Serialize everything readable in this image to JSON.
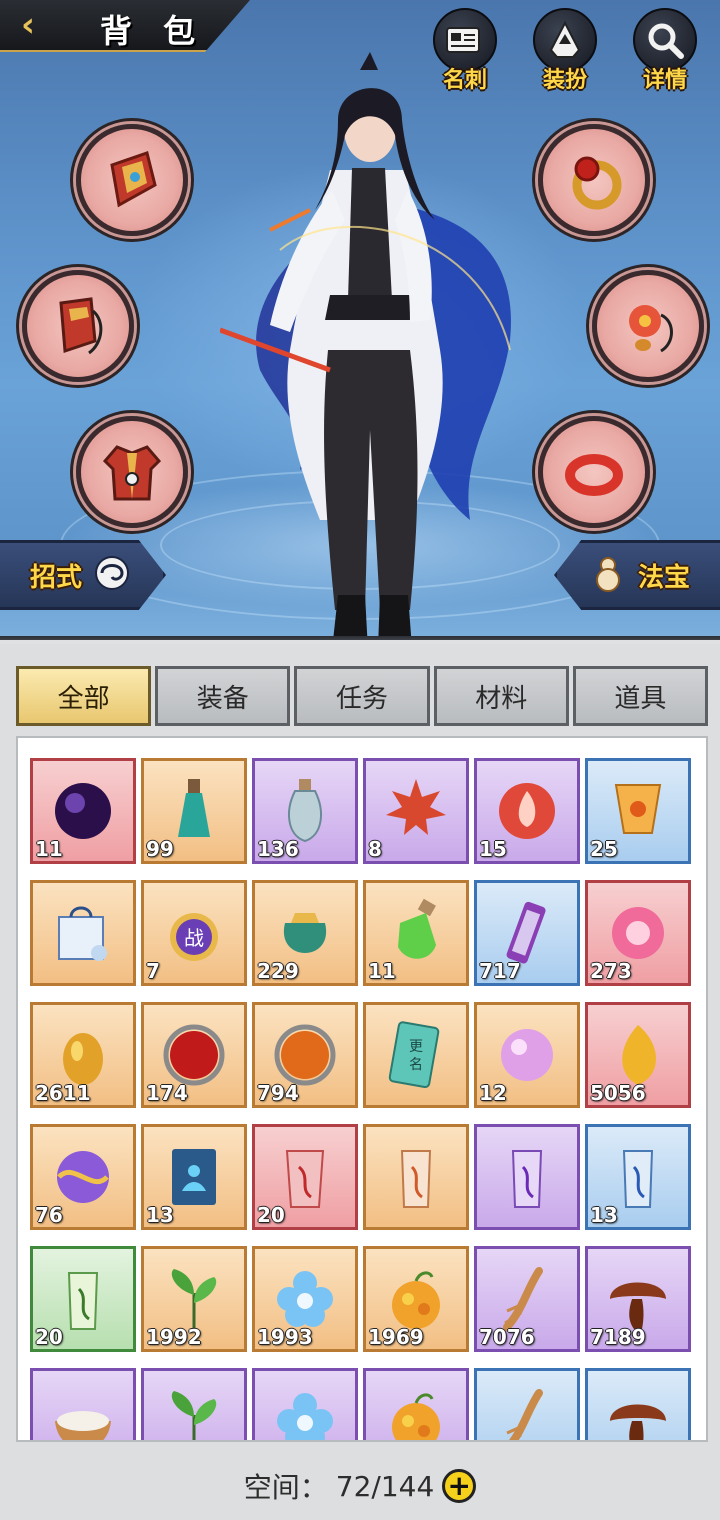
{
  "header": {
    "back_icon": "chevron-left-icon",
    "title": "背 包",
    "buttons": [
      {
        "key": "card",
        "label": "名刺",
        "icon": "name-card-icon"
      },
      {
        "key": "outfit",
        "label": "装扮",
        "icon": "hooded-figure-icon"
      },
      {
        "key": "details",
        "label": "详情",
        "icon": "magnifier-icon"
      }
    ]
  },
  "equipment_slots": {
    "left": [
      {
        "key": "weapon",
        "icon": "bracer-armor-icon"
      },
      {
        "key": "helmet",
        "icon": "hood-icon"
      },
      {
        "key": "armor",
        "icon": "robe-icon"
      }
    ],
    "right": [
      {
        "key": "ring",
        "icon": "gem-ring-icon"
      },
      {
        "key": "amulet",
        "icon": "flower-pendant-icon"
      },
      {
        "key": "bracelet",
        "icon": "red-bangle-icon"
      }
    ]
  },
  "side_tabs": {
    "skills": {
      "label": "招式",
      "icon": "swirl-icon"
    },
    "treasure": {
      "label": "法宝",
      "icon": "gourd-icon"
    }
  },
  "colors": {
    "accent_gold": "#ffd84a",
    "slot_fill": "#e9a9a4",
    "tab_active": "#e8c76f",
    "rarity_red": "#ef9fa3",
    "rarity_orange": "#f2bf84",
    "rarity_purple": "#c9a9ea",
    "rarity_blue": "#a9cdef",
    "rarity_green": "#b7dfaf"
  },
  "tabs": [
    {
      "label": "全部",
      "active": true
    },
    {
      "label": "装备",
      "active": false
    },
    {
      "label": "任务",
      "active": false
    },
    {
      "label": "材料",
      "active": false
    },
    {
      "label": "道具",
      "active": false
    }
  ],
  "items": [
    {
      "icon": "dark-orb-icon",
      "count": "11",
      "rarity": "red"
    },
    {
      "icon": "teal-potion-icon",
      "count": "99",
      "rarity": "orange"
    },
    {
      "icon": "porcelain-vase-icon",
      "count": "136",
      "rarity": "purple"
    },
    {
      "icon": "maple-leaf-icon",
      "count": "8",
      "rarity": "purple"
    },
    {
      "icon": "fire-token-icon",
      "count": "15",
      "rarity": "purple"
    },
    {
      "icon": "sky-lantern-icon",
      "count": "25",
      "rarity": "blue"
    },
    {
      "icon": "gift-bag-icon",
      "count": "",
      "rarity": "orange"
    },
    {
      "icon": "battle-medal-icon",
      "count": "7",
      "rarity": "orange"
    },
    {
      "icon": "green-pouch-icon",
      "count": "229",
      "rarity": "orange"
    },
    {
      "icon": "green-potion-icon",
      "count": "11",
      "rarity": "orange"
    },
    {
      "icon": "purple-scroll-icon",
      "count": "717",
      "rarity": "blue"
    },
    {
      "icon": "lotus-orb-icon",
      "count": "273",
      "rarity": "red"
    },
    {
      "icon": "gold-nugget-icon",
      "count": "2611",
      "rarity": "orange"
    },
    {
      "icon": "red-orb-icon",
      "count": "174",
      "rarity": "orange"
    },
    {
      "icon": "orange-orb-icon",
      "count": "794",
      "rarity": "orange"
    },
    {
      "icon": "rename-card-icon",
      "count": "",
      "rarity": "orange"
    },
    {
      "icon": "pink-pearl-icon",
      "count": "12",
      "rarity": "orange"
    },
    {
      "icon": "gold-leaf-icon",
      "count": "5056",
      "rarity": "red"
    },
    {
      "icon": "galaxy-orb-icon",
      "count": "76",
      "rarity": "orange"
    },
    {
      "icon": "meditation-book-icon",
      "count": "13",
      "rarity": "orange"
    },
    {
      "icon": "red-talisman-icon",
      "count": "20",
      "rarity": "red"
    },
    {
      "icon": "orange-talisman-icon",
      "count": "",
      "rarity": "orange"
    },
    {
      "icon": "purple-talisman-icon",
      "count": "",
      "rarity": "purple"
    },
    {
      "icon": "blue-talisman-icon",
      "count": "13",
      "rarity": "blue"
    },
    {
      "icon": "green-talisman-icon",
      "count": "20",
      "rarity": "green"
    },
    {
      "icon": "tea-sprout-icon",
      "count": "1992",
      "rarity": "orange"
    },
    {
      "icon": "blue-flower-icon",
      "count": "1993",
      "rarity": "orange"
    },
    {
      "icon": "golden-fruit-icon",
      "count": "1969",
      "rarity": "orange"
    },
    {
      "icon": "ginseng-root-icon",
      "count": "7076",
      "rarity": "purple"
    },
    {
      "icon": "lingzhi-mushroom-icon",
      "count": "7189",
      "rarity": "purple"
    },
    {
      "icon": "rice-bowl-icon",
      "count": "",
      "rarity": "purple"
    },
    {
      "icon": "tea-sprout-icon",
      "count": "",
      "rarity": "purple"
    },
    {
      "icon": "blue-flower-icon",
      "count": "",
      "rarity": "purple"
    },
    {
      "icon": "golden-fruit-icon",
      "count": "",
      "rarity": "purple"
    },
    {
      "icon": "ginseng-root-icon",
      "count": "",
      "rarity": "blue"
    },
    {
      "icon": "lingzhi-mushroom-icon",
      "count": "",
      "rarity": "blue"
    }
  ],
  "footer": {
    "space_label": "空间：",
    "space_value": "72/144",
    "add_icon": "plus-icon"
  }
}
